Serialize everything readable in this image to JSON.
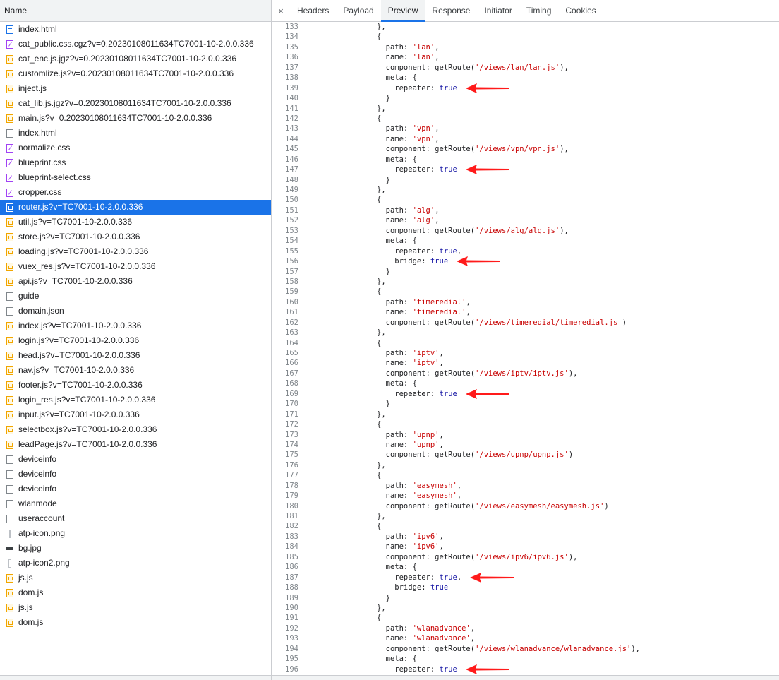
{
  "network": {
    "name_header": "Name",
    "files": [
      {
        "name": "index.html",
        "type": "doc"
      },
      {
        "name": "cat_public.css.cgz?v=0.20230108011634TC7001-10-2.0.0.336",
        "type": "css"
      },
      {
        "name": "cat_enc.js.jgz?v=0.20230108011634TC7001-10-2.0.0.336",
        "type": "js"
      },
      {
        "name": "customlize.js?v=0.20230108011634TC7001-10-2.0.0.336",
        "type": "js"
      },
      {
        "name": "inject.js",
        "type": "js"
      },
      {
        "name": "cat_lib.js.jgz?v=0.20230108011634TC7001-10-2.0.0.336",
        "type": "js"
      },
      {
        "name": "main.js?v=0.20230108011634TC7001-10-2.0.0.336",
        "type": "js"
      },
      {
        "name": "index.html",
        "type": "other"
      },
      {
        "name": "normalize.css",
        "type": "css"
      },
      {
        "name": "blueprint.css",
        "type": "css"
      },
      {
        "name": "blueprint-select.css",
        "type": "css"
      },
      {
        "name": "cropper.css",
        "type": "css"
      },
      {
        "name": "router.js?v=TC7001-10-2.0.0.336",
        "type": "js",
        "selected": true
      },
      {
        "name": "util.js?v=TC7001-10-2.0.0.336",
        "type": "js"
      },
      {
        "name": "store.js?v=TC7001-10-2.0.0.336",
        "type": "js"
      },
      {
        "name": "loading.js?v=TC7001-10-2.0.0.336",
        "type": "js"
      },
      {
        "name": "vuex_res.js?v=TC7001-10-2.0.0.336",
        "type": "js"
      },
      {
        "name": "api.js?v=TC7001-10-2.0.0.336",
        "type": "js"
      },
      {
        "name": "guide",
        "type": "other"
      },
      {
        "name": "domain.json",
        "type": "other"
      },
      {
        "name": "index.js?v=TC7001-10-2.0.0.336",
        "type": "js"
      },
      {
        "name": "login.js?v=TC7001-10-2.0.0.336",
        "type": "js"
      },
      {
        "name": "head.js?v=TC7001-10-2.0.0.336",
        "type": "js"
      },
      {
        "name": "nav.js?v=TC7001-10-2.0.0.336",
        "type": "js"
      },
      {
        "name": "footer.js?v=TC7001-10-2.0.0.336",
        "type": "js"
      },
      {
        "name": "login_res.js?v=TC7001-10-2.0.0.336",
        "type": "js"
      },
      {
        "name": "input.js?v=TC7001-10-2.0.0.336",
        "type": "js"
      },
      {
        "name": "selectbox.js?v=TC7001-10-2.0.0.336",
        "type": "js"
      },
      {
        "name": "leadPage.js?v=TC7001-10-2.0.0.336",
        "type": "js"
      },
      {
        "name": "deviceinfo",
        "type": "other"
      },
      {
        "name": "deviceinfo",
        "type": "other"
      },
      {
        "name": "deviceinfo",
        "type": "other"
      },
      {
        "name": "wlanmode",
        "type": "other"
      },
      {
        "name": "useraccount",
        "type": "other"
      },
      {
        "name": "atp-icon.png",
        "type": "img"
      },
      {
        "name": "bg.jpg",
        "type": "dark"
      },
      {
        "name": "atp-icon2.png",
        "type": "img2"
      },
      {
        "name": "js.js",
        "type": "js"
      },
      {
        "name": "dom.js",
        "type": "js"
      },
      {
        "name": "js.js",
        "type": "js"
      },
      {
        "name": "dom.js",
        "type": "js"
      }
    ]
  },
  "tabs": {
    "close_symbol": "×",
    "items": [
      {
        "label": "Headers"
      },
      {
        "label": "Payload"
      },
      {
        "label": "Preview",
        "active": true
      },
      {
        "label": "Response"
      },
      {
        "label": "Initiator"
      },
      {
        "label": "Timing"
      },
      {
        "label": "Cookies"
      }
    ]
  },
  "code": {
    "lines": [
      {
        "n": "133",
        "t": "},"
      },
      {
        "n": "134",
        "t": "{"
      },
      {
        "n": "135",
        "t": "  path: 'lan',"
      },
      {
        "n": "136",
        "t": "  name: 'lan',"
      },
      {
        "n": "137",
        "t": "  component: getRoute('/views/lan/lan.js'),"
      },
      {
        "n": "138",
        "t": "  meta: {"
      },
      {
        "n": "139",
        "t": "    repeater: true",
        "arrow": true
      },
      {
        "n": "140",
        "t": "  }"
      },
      {
        "n": "141",
        "t": "},"
      },
      {
        "n": "142",
        "t": "{"
      },
      {
        "n": "143",
        "t": "  path: 'vpn',"
      },
      {
        "n": "144",
        "t": "  name: 'vpn',"
      },
      {
        "n": "145",
        "t": "  component: getRoute('/views/vpn/vpn.js'),"
      },
      {
        "n": "146",
        "t": "  meta: {"
      },
      {
        "n": "147",
        "t": "    repeater: true",
        "arrow": true
      },
      {
        "n": "148",
        "t": "  }"
      },
      {
        "n": "149",
        "t": "},"
      },
      {
        "n": "150",
        "t": "{"
      },
      {
        "n": "151",
        "t": "  path: 'alg',"
      },
      {
        "n": "152",
        "t": "  name: 'alg',"
      },
      {
        "n": "153",
        "t": "  component: getRoute('/views/alg/alg.js'),"
      },
      {
        "n": "154",
        "t": "  meta: {"
      },
      {
        "n": "155",
        "t": "    repeater: true,"
      },
      {
        "n": "156",
        "t": "    bridge: true",
        "arrow": true
      },
      {
        "n": "157",
        "t": "  }"
      },
      {
        "n": "158",
        "t": "},"
      },
      {
        "n": "159",
        "t": "{"
      },
      {
        "n": "160",
        "t": "  path: 'timeredial',"
      },
      {
        "n": "161",
        "t": "  name: 'timeredial',"
      },
      {
        "n": "162",
        "t": "  component: getRoute('/views/timeredial/timeredial.js')"
      },
      {
        "n": "163",
        "t": "},"
      },
      {
        "n": "164",
        "t": "{"
      },
      {
        "n": "165",
        "t": "  path: 'iptv',"
      },
      {
        "n": "166",
        "t": "  name: 'iptv',"
      },
      {
        "n": "167",
        "t": "  component: getRoute('/views/iptv/iptv.js'),"
      },
      {
        "n": "168",
        "t": "  meta: {"
      },
      {
        "n": "169",
        "t": "    repeater: true",
        "arrow": true
      },
      {
        "n": "170",
        "t": "  }"
      },
      {
        "n": "171",
        "t": "},"
      },
      {
        "n": "172",
        "t": "{"
      },
      {
        "n": "173",
        "t": "  path: 'upnp',"
      },
      {
        "n": "174",
        "t": "  name: 'upnp',"
      },
      {
        "n": "175",
        "t": "  component: getRoute('/views/upnp/upnp.js')"
      },
      {
        "n": "176",
        "t": "},"
      },
      {
        "n": "177",
        "t": "{"
      },
      {
        "n": "178",
        "t": "  path: 'easymesh',"
      },
      {
        "n": "179",
        "t": "  name: 'easymesh',"
      },
      {
        "n": "180",
        "t": "  component: getRoute('/views/easymesh/easymesh.js')"
      },
      {
        "n": "181",
        "t": "},"
      },
      {
        "n": "182",
        "t": "{"
      },
      {
        "n": "183",
        "t": "  path: 'ipv6',"
      },
      {
        "n": "184",
        "t": "  name: 'ipv6',"
      },
      {
        "n": "185",
        "t": "  component: getRoute('/views/ipv6/ipv6.js'),"
      },
      {
        "n": "186",
        "t": "  meta: {"
      },
      {
        "n": "187",
        "t": "    repeater: true,",
        "arrow": true
      },
      {
        "n": "188",
        "t": "    bridge: true"
      },
      {
        "n": "189",
        "t": "  }"
      },
      {
        "n": "190",
        "t": "},"
      },
      {
        "n": "191",
        "t": "{"
      },
      {
        "n": "192",
        "t": "  path: 'wlanadvance',"
      },
      {
        "n": "193",
        "t": "  name: 'wlanadvance',"
      },
      {
        "n": "194",
        "t": "  component: getRoute('/views/wlanadvance/wlanadvance.js'),"
      },
      {
        "n": "195",
        "t": "  meta: {"
      },
      {
        "n": "196",
        "t": "    repeater: true",
        "arrow": true
      }
    ]
  },
  "colors": {
    "selection": "#1a73e8",
    "string": "#c80000",
    "keyword": "#1a1aa6",
    "arrow": "#ff1a1a"
  }
}
